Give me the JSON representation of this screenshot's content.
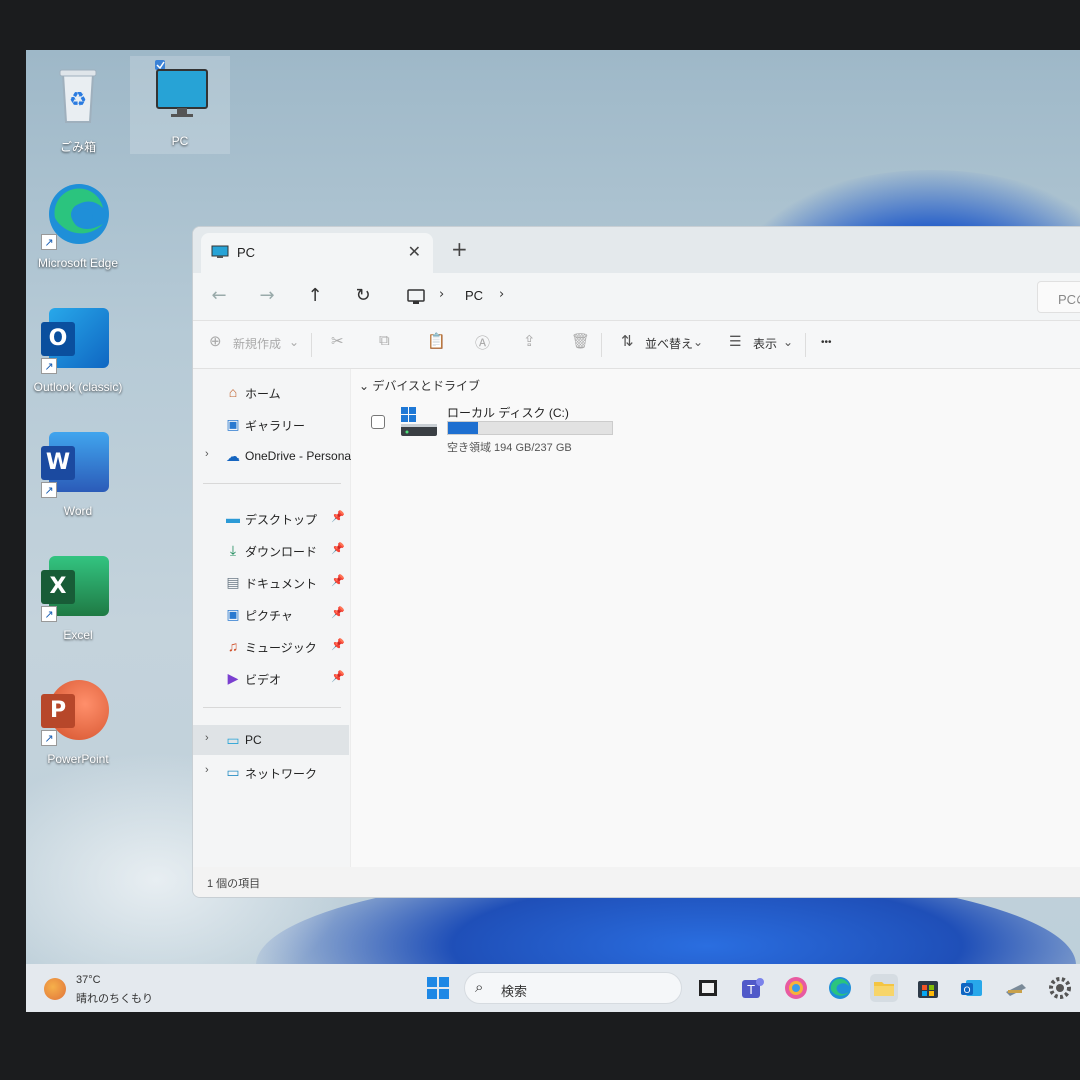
{
  "desktop": {
    "icons": [
      {
        "label": "ごみ箱",
        "icon": "recycle-bin-icon"
      },
      {
        "label": "PC",
        "icon": "pc-monitor-icon"
      },
      {
        "label": "Microsoft Edge",
        "icon": "edge-icon"
      },
      {
        "label": "Outlook (classic)",
        "icon": "outlook-icon",
        "letter": "O"
      },
      {
        "label": "Word",
        "icon": "word-icon",
        "letter": "W"
      },
      {
        "label": "Excel",
        "icon": "excel-icon",
        "letter": "X"
      },
      {
        "label": "PowerPoint",
        "icon": "powerpoint-icon",
        "letter": "P"
      }
    ]
  },
  "explorer": {
    "tab_title": "PC",
    "tab_close": "✕",
    "new_tab": "+",
    "address": {
      "crumb": "PC",
      "sep": "›"
    },
    "search_placeholder": "PCの",
    "toolbar": {
      "new_label": "新規作成",
      "sort_label": "並べ替え",
      "view_label": "表示",
      "more_label": "•••"
    },
    "sidebar": {
      "home": "ホーム",
      "gallery": "ギャラリー",
      "onedrive": "OneDrive - Persona",
      "desktop": "デスクトップ",
      "downloads": "ダウンロード",
      "documents": "ドキュメント",
      "pictures": "ピクチャ",
      "music": "ミュージック",
      "videos": "ビデオ",
      "pc": "PC",
      "network": "ネットワーク"
    },
    "content": {
      "group_header": "デバイスとドライブ",
      "drive_name": "ローカル ディスク (C:)",
      "drive_free_text": "空き領域 194 GB/237 GB",
      "drive_used_fraction": 0.18
    },
    "status": "1 個の項目"
  },
  "taskbar": {
    "weather_temp": "37°C",
    "weather_cond": "晴れのちくもり",
    "search_placeholder": "検索"
  },
  "colors": {
    "accent": "#1e6fd0",
    "excel": "#1f7a44",
    "word": "#2b5bb8",
    "outlook": "#0f66c2",
    "powerpoint": "#d2502a"
  }
}
